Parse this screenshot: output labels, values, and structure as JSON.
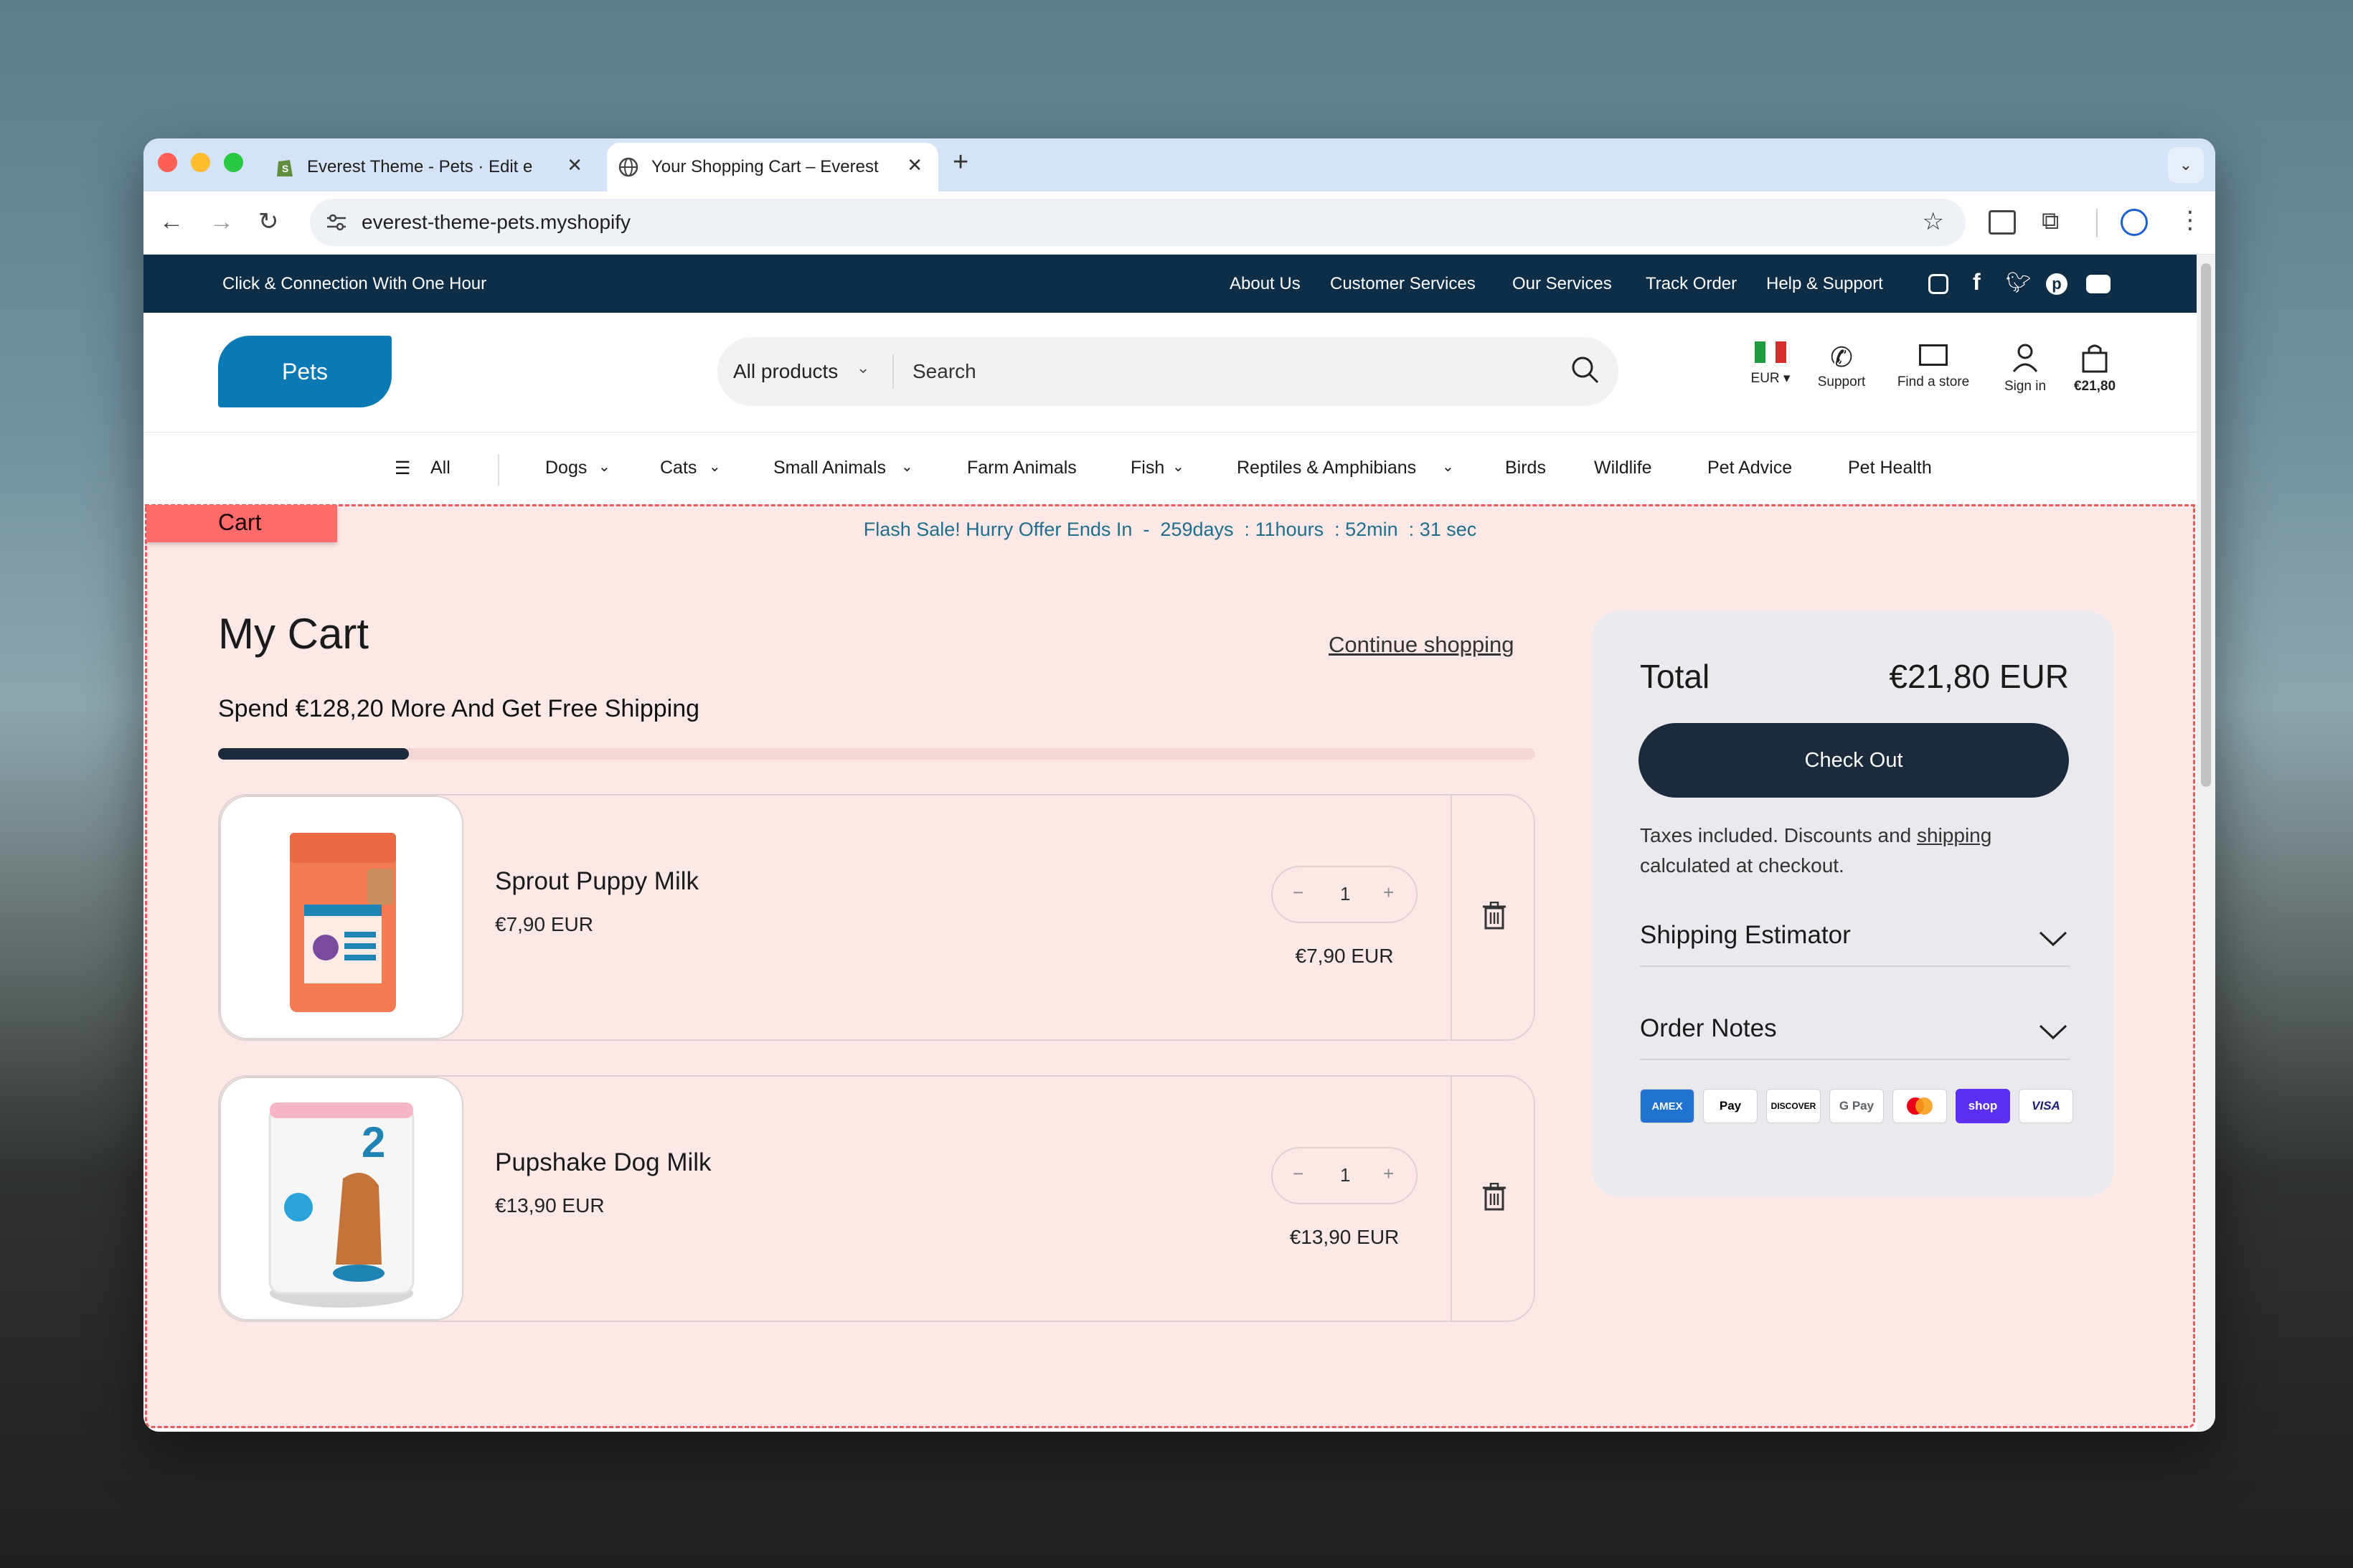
{
  "browser": {
    "tabs": [
      {
        "title": "Everest Theme - Pets · Edit e"
      },
      {
        "title": "Your Shopping Cart – Everest"
      }
    ],
    "new_tab": "+",
    "url": "everest-theme-pets.myshopify"
  },
  "topbar": {
    "promo": "Click & Connection With One Hour",
    "links": [
      "About Us",
      "Customer Services",
      "Our Services",
      "Track Order",
      "Help & Support"
    ]
  },
  "header": {
    "logo": "Pets",
    "search_category": "All products",
    "search_placeholder": "Search",
    "currency": "EUR",
    "support": "Support",
    "find_store": "Find a store",
    "sign_in": "Sign in",
    "cart_total": "€21,80"
  },
  "menu": [
    "All",
    "Dogs",
    "Cats",
    "Small Animals",
    "Farm Animals",
    "Fish",
    "Reptiles & Amphibians",
    "Birds",
    "Wildlife",
    "Pet Advice",
    "Pet Health"
  ],
  "cart": {
    "tag": "Cart",
    "flash": {
      "label": "Flash Sale! Hurry Offer Ends In",
      "sep": "-",
      "days": "259days",
      "hours": "11hours",
      "mins": "52min",
      "secs": "31 sec"
    },
    "title": "My Cart",
    "continue": "Continue shopping",
    "shipping_msg": "Spend €128,20 More And Get Free Shipping",
    "shipping_progress": 0.145,
    "items": [
      {
        "name": "Sprout Puppy Milk",
        "price": "€7,90 EUR",
        "qty": "1",
        "line_total": "€7,90 EUR"
      },
      {
        "name": "Pupshake Dog Milk",
        "price": "€13,90 EUR",
        "qty": "1",
        "line_total": "€13,90 EUR"
      }
    ]
  },
  "summary": {
    "total_label": "Total",
    "total_value": "€21,80 EUR",
    "checkout": "Check Out",
    "tax_pre": "Taxes included. Discounts and ",
    "tax_link": "shipping",
    "tax_post": "calculated at checkout.",
    "shipping_estimator": "Shipping Estimator",
    "order_notes": "Order Notes",
    "payments": [
      "AMEX",
      "Pay",
      "DISCOVER",
      "G Pay",
      "",
      "shop",
      "VISA"
    ]
  }
}
